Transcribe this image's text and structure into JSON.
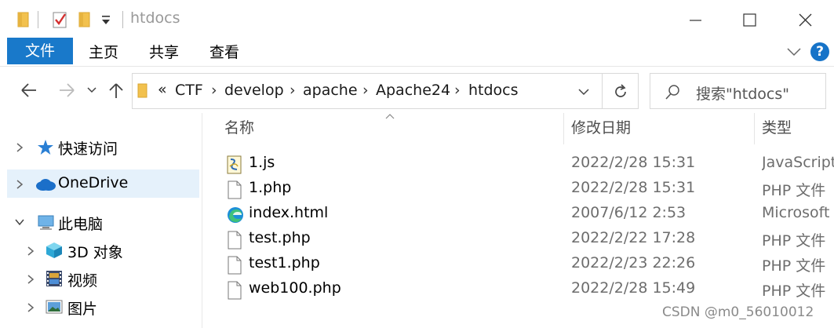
{
  "window": {
    "title": "htdocs",
    "minimize_glyph": "—",
    "maximize_glyph": "☐",
    "close_glyph": "✕"
  },
  "ribbon": {
    "tabs": [
      "文件",
      "主页",
      "共享",
      "查看"
    ],
    "help_label": "?"
  },
  "address": {
    "overflow_glyph": "«",
    "crumbs": [
      "CTF",
      "develop",
      "apache",
      "Apache24",
      "htdocs"
    ]
  },
  "search": {
    "placeholder": "搜索\"htdocs\""
  },
  "sidebar": {
    "items": [
      {
        "label": "快速访问",
        "icon": "star-icon",
        "expanded": false,
        "selected": false
      },
      {
        "label": "OneDrive",
        "icon": "cloud-icon",
        "expanded": false,
        "selected": true
      },
      {
        "label": "此电脑",
        "icon": "computer-icon",
        "expanded": true,
        "selected": false
      },
      {
        "label": "3D 对象",
        "icon": "cube-icon",
        "expanded": false,
        "selected": false
      },
      {
        "label": "视频",
        "icon": "film-icon",
        "expanded": false,
        "selected": false
      },
      {
        "label": "图片",
        "icon": "picture-icon",
        "expanded": false,
        "selected": false
      }
    ]
  },
  "columns": {
    "name": "名称",
    "date": "修改日期",
    "type": "类型"
  },
  "files": [
    {
      "name": "1.js",
      "date": "2022/2/28 15:31",
      "type": "JavaScript",
      "icon": "script-file-icon"
    },
    {
      "name": "1.php",
      "date": "2022/2/28 15:31",
      "type": "PHP 文件",
      "icon": "blank-file-icon"
    },
    {
      "name": "index.html",
      "date": "2007/6/12 2:53",
      "type": "Microsoft E",
      "icon": "edge-icon"
    },
    {
      "name": "test.php",
      "date": "2022/2/22 17:28",
      "type": "PHP 文件",
      "icon": "blank-file-icon"
    },
    {
      "name": "test1.php",
      "date": "2022/2/23 22:26",
      "type": "PHP 文件",
      "icon": "blank-file-icon"
    },
    {
      "name": "web100.php",
      "date": "2022/2/28 15:49",
      "type": "PHP 文件",
      "icon": "blank-file-icon"
    }
  ],
  "watermark": "CSDN @m0_56010012",
  "colors": {
    "accent": "#1979ca",
    "selection": "#e5f1fb"
  }
}
